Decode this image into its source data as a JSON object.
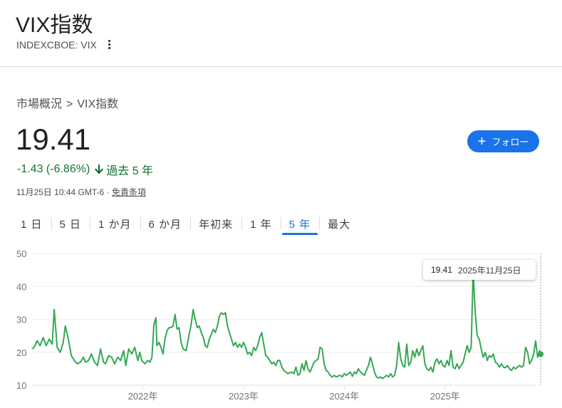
{
  "header": {
    "title": "VIX指数",
    "subtitle": "INDEXCBOE: VIX"
  },
  "breadcrumb": {
    "root": "市場概況",
    "separator": ">",
    "current": "VIX指数"
  },
  "quote": {
    "price": "19.41",
    "change": "-1.43 (-6.86%)",
    "period": "過去 5 年",
    "timestamp": "11月25日 10:44 GMT-6",
    "separator": "·",
    "disclaimer": "免責条項"
  },
  "follow_button": {
    "label": "フォロー",
    "icon": "plus-icon"
  },
  "tabs": [
    {
      "label": "1 日",
      "active": false
    },
    {
      "label": "5 日",
      "active": false
    },
    {
      "label": "1 か月",
      "active": false
    },
    {
      "label": "6 か月",
      "active": false
    },
    {
      "label": "年初来",
      "active": false
    },
    {
      "label": "1 年",
      "active": false
    },
    {
      "label": "5 年",
      "active": true
    },
    {
      "label": "最大",
      "active": false
    }
  ],
  "tooltip": {
    "value": "19.41",
    "date": "2025年11月25日"
  },
  "colors": {
    "line": "#34a853",
    "accent": "#1a73e8",
    "positive_text": "#137333",
    "grid": "#eeeeee"
  },
  "chart_data": {
    "type": "line",
    "title": "",
    "xlabel": "",
    "ylabel": "",
    "ylim": [
      10,
      50
    ],
    "yticks": [
      10,
      20,
      30,
      40,
      50
    ],
    "xlim": [
      2020.9,
      2025.9
    ],
    "xticks": [
      {
        "label": "2022年",
        "x": 2022.0
      },
      {
        "label": "2023年",
        "x": 2023.0
      },
      {
        "label": "2024年",
        "x": 2024.0
      },
      {
        "label": "2025年",
        "x": 2025.0
      }
    ],
    "grid": true,
    "series": [
      {
        "values": [
          [
            2020.9,
            21
          ],
          [
            2020.92,
            21.5
          ],
          [
            2020.95,
            23.5
          ],
          [
            2020.98,
            22
          ],
          [
            2021.01,
            24.5
          ],
          [
            2021.04,
            22
          ],
          [
            2021.07,
            24
          ],
          [
            2021.1,
            22.5
          ],
          [
            2021.12,
            33
          ],
          [
            2021.15,
            21.5
          ],
          [
            2021.18,
            20
          ],
          [
            2021.21,
            23
          ],
          [
            2021.23,
            28
          ],
          [
            2021.26,
            24
          ],
          [
            2021.29,
            19
          ],
          [
            2021.32,
            17.5
          ],
          [
            2021.35,
            16.5
          ],
          [
            2021.38,
            17
          ],
          [
            2021.41,
            18.5
          ],
          [
            2021.43,
            17
          ],
          [
            2021.46,
            17.5
          ],
          [
            2021.49,
            19.5
          ],
          [
            2021.52,
            17
          ],
          [
            2021.55,
            16
          ],
          [
            2021.58,
            21
          ],
          [
            2021.61,
            17
          ],
          [
            2021.63,
            16.5
          ],
          [
            2021.66,
            19
          ],
          [
            2021.69,
            18.5
          ],
          [
            2021.72,
            16.5
          ],
          [
            2021.75,
            18.5
          ],
          [
            2021.78,
            17.5
          ],
          [
            2021.81,
            20.5
          ],
          [
            2021.83,
            16
          ],
          [
            2021.86,
            21
          ],
          [
            2021.89,
            19.5
          ],
          [
            2021.92,
            21.5
          ],
          [
            2021.95,
            17.5
          ],
          [
            2021.97,
            20
          ],
          [
            2021.99,
            17.5
          ],
          [
            2022.02,
            16.5
          ],
          [
            2022.05,
            17.5
          ],
          [
            2022.07,
            17
          ],
          [
            2022.09,
            18.5
          ],
          [
            2022.11,
            28.5
          ],
          [
            2022.13,
            30.5
          ],
          [
            2022.14,
            22
          ],
          [
            2022.16,
            23
          ],
          [
            2022.18,
            21.5
          ],
          [
            2022.2,
            19.5
          ],
          [
            2022.22,
            24
          ],
          [
            2022.24,
            26.5
          ],
          [
            2022.26,
            27.5
          ],
          [
            2022.28,
            27.5
          ],
          [
            2022.3,
            28
          ],
          [
            2022.32,
            31.5
          ],
          [
            2022.34,
            27
          ],
          [
            2022.36,
            27.5
          ],
          [
            2022.38,
            23
          ],
          [
            2022.4,
            21
          ],
          [
            2022.43,
            20.5
          ],
          [
            2022.46,
            25.5
          ],
          [
            2022.48,
            28.5
          ],
          [
            2022.5,
            33
          ],
          [
            2022.52,
            30
          ],
          [
            2022.54,
            27.5
          ],
          [
            2022.56,
            28
          ],
          [
            2022.58,
            26
          ],
          [
            2022.6,
            24.5
          ],
          [
            2022.62,
            22
          ],
          [
            2022.64,
            21.5
          ],
          [
            2022.66,
            24
          ],
          [
            2022.68,
            25.5
          ],
          [
            2022.7,
            27
          ],
          [
            2022.72,
            26
          ],
          [
            2022.74,
            28
          ],
          [
            2022.76,
            31
          ],
          [
            2022.78,
            32
          ],
          [
            2022.8,
            31.5
          ],
          [
            2022.82,
            32
          ],
          [
            2022.84,
            28
          ],
          [
            2022.86,
            26
          ],
          [
            2022.88,
            24
          ],
          [
            2022.9,
            22
          ],
          [
            2022.92,
            23
          ],
          [
            2022.94,
            21.5
          ],
          [
            2022.96,
            22.5
          ],
          [
            2022.98,
            21.5
          ],
          [
            2023.0,
            23
          ],
          [
            2023.02,
            21.5
          ],
          [
            2023.04,
            19.5
          ],
          [
            2023.06,
            20
          ],
          [
            2023.08,
            19
          ],
          [
            2023.1,
            21.5
          ],
          [
            2023.12,
            20.5
          ],
          [
            2023.14,
            22
          ],
          [
            2023.16,
            24.5
          ],
          [
            2023.18,
            26
          ],
          [
            2023.2,
            22.5
          ],
          [
            2023.22,
            19
          ],
          [
            2023.24,
            18.5
          ],
          [
            2023.26,
            17.5
          ],
          [
            2023.28,
            16.5
          ],
          [
            2023.3,
            17
          ],
          [
            2023.32,
            16
          ],
          [
            2023.34,
            17.5
          ],
          [
            2023.36,
            17.5
          ],
          [
            2023.38,
            15.5
          ],
          [
            2023.4,
            14.5
          ],
          [
            2023.42,
            14
          ],
          [
            2023.44,
            13.5
          ],
          [
            2023.46,
            13.8
          ],
          [
            2023.48,
            14
          ],
          [
            2023.5,
            13.5
          ],
          [
            2023.52,
            15.5
          ],
          [
            2023.54,
            13
          ],
          [
            2023.56,
            13.5
          ],
          [
            2023.58,
            16.5
          ],
          [
            2023.6,
            14.5
          ],
          [
            2023.62,
            17.5
          ],
          [
            2023.64,
            15
          ],
          [
            2023.66,
            14
          ],
          [
            2023.68,
            15.5
          ],
          [
            2023.7,
            17
          ],
          [
            2023.72,
            17.5
          ],
          [
            2023.74,
            18
          ],
          [
            2023.76,
            21.5
          ],
          [
            2023.78,
            21
          ],
          [
            2023.8,
            16.5
          ],
          [
            2023.82,
            14.5
          ],
          [
            2023.84,
            14
          ],
          [
            2023.86,
            13
          ],
          [
            2023.88,
            12.5
          ],
          [
            2023.9,
            13
          ],
          [
            2023.92,
            12.5
          ],
          [
            2023.94,
            12.8
          ],
          [
            2023.96,
            13
          ],
          [
            2023.98,
            12.5
          ],
          [
            2024.0,
            13.5
          ],
          [
            2024.02,
            13
          ],
          [
            2024.04,
            13.5
          ],
          [
            2024.06,
            14
          ],
          [
            2024.08,
            12.7
          ],
          [
            2024.1,
            14
          ],
          [
            2024.12,
            13.5
          ],
          [
            2024.14,
            15
          ],
          [
            2024.16,
            14
          ],
          [
            2024.18,
            13.5
          ],
          [
            2024.2,
            13
          ],
          [
            2024.22,
            14.5
          ],
          [
            2024.24,
            16
          ],
          [
            2024.26,
            18.5
          ],
          [
            2024.28,
            16.5
          ],
          [
            2024.3,
            14
          ],
          [
            2024.32,
            12.5
          ],
          [
            2024.34,
            12.2
          ],
          [
            2024.36,
            12.5
          ],
          [
            2024.38,
            12
          ],
          [
            2024.4,
            12.5
          ],
          [
            2024.42,
            13
          ],
          [
            2024.44,
            12.5
          ],
          [
            2024.46,
            13.5
          ],
          [
            2024.48,
            12.5
          ],
          [
            2024.5,
            13
          ],
          [
            2024.52,
            16
          ],
          [
            2024.54,
            23
          ],
          [
            2024.56,
            18
          ],
          [
            2024.58,
            16
          ],
          [
            2024.6,
            15.5
          ],
          [
            2024.62,
            22.5
          ],
          [
            2024.64,
            16
          ],
          [
            2024.66,
            17
          ],
          [
            2024.68,
            20.5
          ],
          [
            2024.7,
            18.5
          ],
          [
            2024.72,
            21
          ],
          [
            2024.74,
            19
          ],
          [
            2024.76,
            20.5
          ],
          [
            2024.78,
            22
          ],
          [
            2024.8,
            16.5
          ],
          [
            2024.82,
            15
          ],
          [
            2024.84,
            14.5
          ],
          [
            2024.86,
            15.5
          ],
          [
            2024.88,
            14
          ],
          [
            2024.9,
            17
          ],
          [
            2024.92,
            18
          ],
          [
            2024.94,
            16.5
          ],
          [
            2024.96,
            17.5
          ],
          [
            2024.98,
            16
          ],
          [
            2025.0,
            15.5
          ],
          [
            2025.02,
            17.5
          ],
          [
            2025.04,
            16
          ],
          [
            2025.06,
            20.5
          ],
          [
            2025.08,
            15.5
          ],
          [
            2025.1,
            15
          ],
          [
            2025.12,
            16.5
          ],
          [
            2025.14,
            15
          ],
          [
            2025.16,
            16
          ],
          [
            2025.18,
            17
          ],
          [
            2025.2,
            19.5
          ],
          [
            2025.22,
            22
          ],
          [
            2025.24,
            20
          ],
          [
            2025.26,
            21.5
          ],
          [
            2025.28,
            45
          ],
          [
            2025.29,
            38
          ],
          [
            2025.3,
            32
          ],
          [
            2025.32,
            25
          ],
          [
            2025.34,
            24
          ],
          [
            2025.36,
            21
          ],
          [
            2025.38,
            18.5
          ],
          [
            2025.4,
            20
          ],
          [
            2025.42,
            17.5
          ],
          [
            2025.44,
            19
          ],
          [
            2025.46,
            18.5
          ],
          [
            2025.48,
            19.5
          ],
          [
            2025.5,
            17
          ],
          [
            2025.52,
            16.5
          ],
          [
            2025.54,
            15.5
          ],
          [
            2025.56,
            16.5
          ],
          [
            2025.58,
            15.5
          ],
          [
            2025.6,
            15.3
          ],
          [
            2025.62,
            16
          ],
          [
            2025.64,
            15
          ],
          [
            2025.66,
            14.5
          ],
          [
            2025.68,
            15.5
          ],
          [
            2025.7,
            15
          ],
          [
            2025.72,
            15.5
          ],
          [
            2025.74,
            16
          ],
          [
            2025.76,
            15.5
          ],
          [
            2025.78,
            16
          ],
          [
            2025.8,
            21.5
          ],
          [
            2025.82,
            20
          ],
          [
            2025.84,
            16.5
          ],
          [
            2025.86,
            17.5
          ],
          [
            2025.88,
            19.5
          ],
          [
            2025.9,
            23.5
          ],
          [
            2025.92,
            18.5
          ],
          [
            2025.94,
            20.5
          ],
          [
            2025.95,
            19.41
          ]
        ]
      }
    ]
  }
}
